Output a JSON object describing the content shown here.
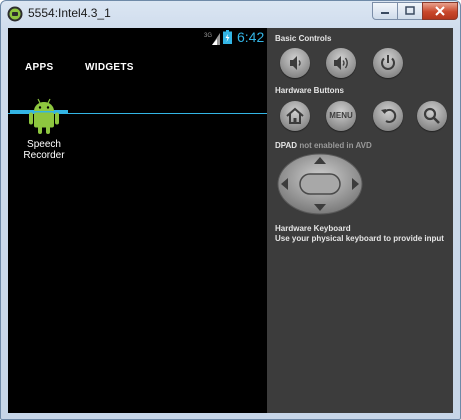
{
  "window": {
    "title": "5554:Intel4.3_1"
  },
  "status_bar": {
    "network": "3G",
    "time": "6:42"
  },
  "tabs": [
    {
      "label": "APPS"
    },
    {
      "label": "WIDGETS"
    }
  ],
  "apps": [
    {
      "label": "Speech Recorder",
      "icon": "android-robot-icon"
    }
  ],
  "panel": {
    "basic_controls": "Basic Controls",
    "hardware_buttons": "Hardware Buttons",
    "dpad_label": "DPAD",
    "dpad_note": "not enabled in AVD",
    "menu_label": "MENU",
    "keyboard_title": "Hardware Keyboard",
    "keyboard_text": "Use your physical keyboard to provide input"
  },
  "colors": {
    "accent": "#33b5e5",
    "panel": "#3c3c3c",
    "android_green": "#8dc63f"
  }
}
